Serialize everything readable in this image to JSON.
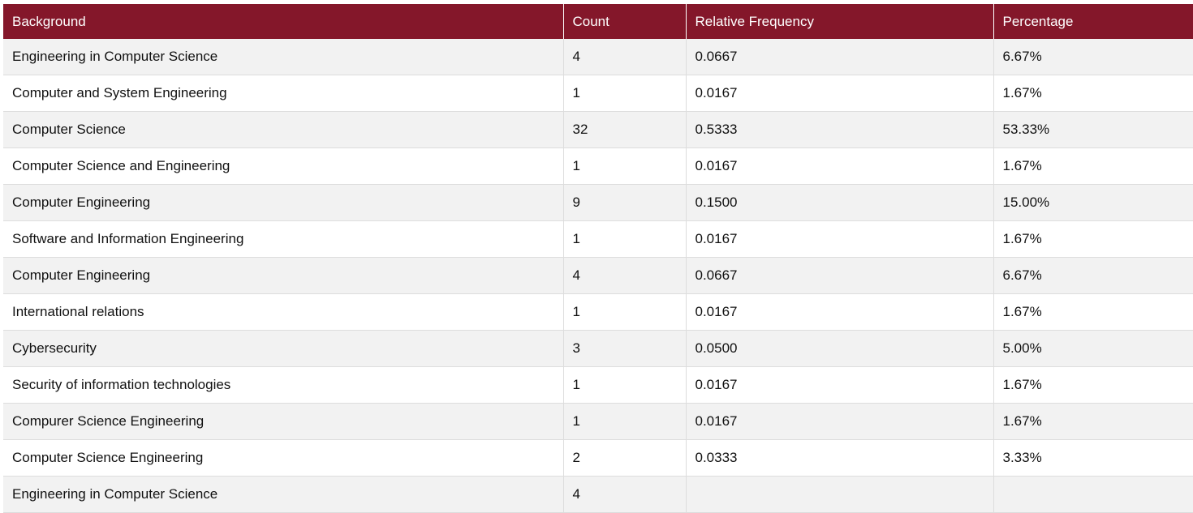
{
  "table": {
    "headers": [
      "Background",
      "Count",
      "Relative Frequency",
      "Percentage"
    ],
    "rows": [
      [
        "Engineering in Computer Science",
        "4",
        "0.0667",
        "6.67%"
      ],
      [
        "Computer and System Engineering",
        "1",
        "0.0167",
        "1.67%"
      ],
      [
        "Computer Science",
        "32",
        "0.5333",
        "53.33%"
      ],
      [
        "Computer Science and Engineering",
        "1",
        "0.0167",
        "1.67%"
      ],
      [
        "Computer Engineering",
        "9",
        "0.1500",
        "15.00%"
      ],
      [
        "Software and Information Engineering",
        "1",
        "0.0167",
        "1.67%"
      ],
      [
        "Computer Engineering",
        "4",
        "0.0667",
        "6.67%"
      ],
      [
        "International relations",
        "1",
        "0.0167",
        "1.67%"
      ],
      [
        "Cybersecurity",
        "3",
        "0.0500",
        "5.00%"
      ],
      [
        "Security of information technologies",
        "1",
        "0.0167",
        "1.67%"
      ],
      [
        "Compurer Science Engineering",
        "1",
        "0.0167",
        "1.67%"
      ],
      [
        "Computer Science Engineering",
        "2",
        "0.0333",
        "3.33%"
      ],
      [
        "Engineering in Computer Science",
        "4",
        "",
        ""
      ]
    ]
  },
  "colors": {
    "header_background": "#84172a",
    "header_text": "#ffffff",
    "stripe_row": "#f2f2f2"
  }
}
